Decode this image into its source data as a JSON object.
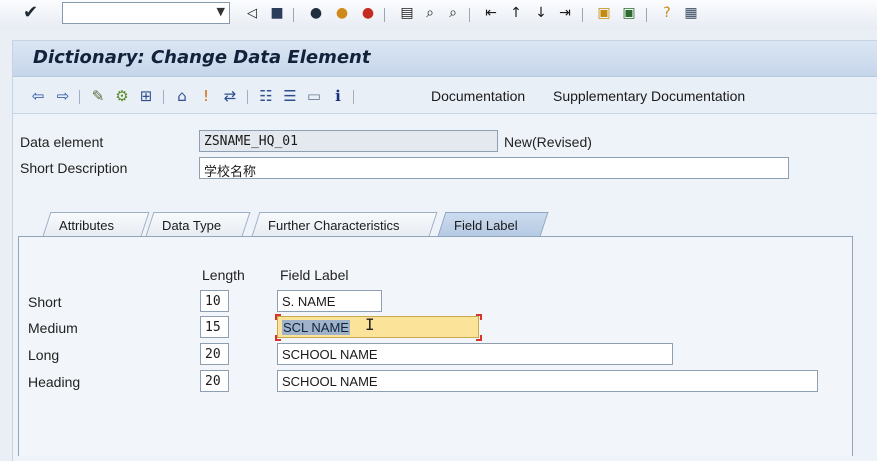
{
  "system_toolbar": {
    "command_field_value": "",
    "icons": [
      "enter-icon",
      "back-icon",
      "save-icon",
      "back-green-icon",
      "exit-icon",
      "cancel-icon",
      "print-icon",
      "find-icon",
      "find-next-icon",
      "first-page-icon",
      "prev-page-icon",
      "next-page-icon",
      "last-page-icon",
      "new-session-icon",
      "shortcut-icon",
      "help-icon",
      "layout-icon"
    ]
  },
  "title": "Dictionary: Change Data Element",
  "app_toolbar": {
    "documentation_label": "Documentation",
    "supplementary_label": "Supplementary Documentation"
  },
  "header": {
    "data_element_label": "Data element",
    "data_element_value": "ZSNAME_HQ_01",
    "status": "New(Revised)",
    "short_description_label": "Short Description",
    "short_description_value": "学校名称"
  },
  "tabs": [
    {
      "label": "Attributes"
    },
    {
      "label": "Data Type"
    },
    {
      "label": "Further Characteristics"
    },
    {
      "label": "Field Label"
    }
  ],
  "field_label_tab": {
    "length_header": "Length",
    "field_label_header": "Field Label",
    "rows": [
      {
        "name": "Short",
        "length": "10",
        "label": "S. NAME"
      },
      {
        "name": "Medium",
        "length": "15",
        "label": "SCL NAME"
      },
      {
        "name": "Long",
        "length": "20",
        "label": "SCHOOL NAME"
      },
      {
        "name": "Heading",
        "length": "20",
        "label": "SCHOOL NAME"
      }
    ]
  }
}
